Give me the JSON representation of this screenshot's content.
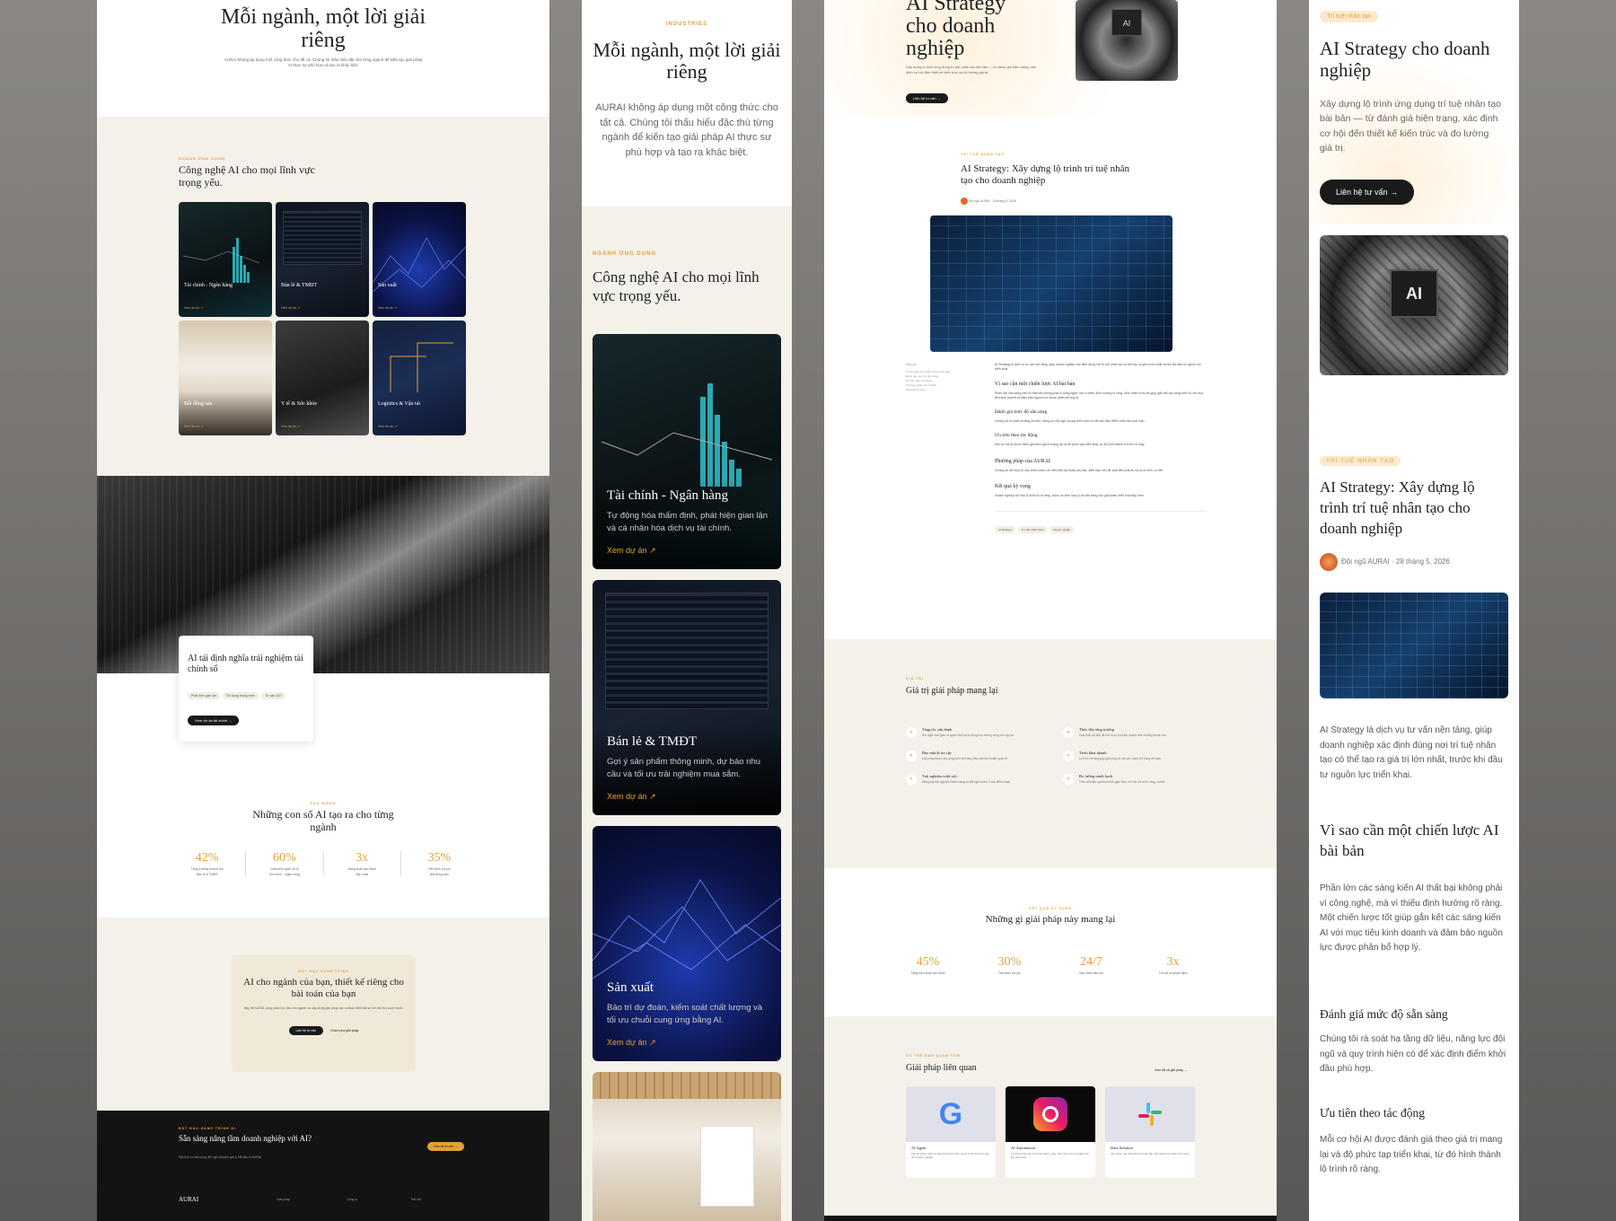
{
  "p1": {
    "hero_title": "Mỗi ngành, một lời giải riêng",
    "hero_desc": "AURAI không áp dụng một công thức cho tất cả. Chúng tôi thấu hiểu đặc thù từng ngành để kiến tạo giải pháp AI thực sự phù hợp và tạo ra khác biệt.",
    "section_eyebrow": "Ngành ứng dụng",
    "section_title": "Công nghệ AI cho mọi lĩnh vực trọng yếu.",
    "cards": [
      {
        "title": "Tài chính - Ngân hàng",
        "link": "Xem dự án"
      },
      {
        "title": "Bán lẻ & TMĐT",
        "link": "Xem dự án"
      },
      {
        "title": "Sản xuất",
        "link": "Xem dự án"
      },
      {
        "title": "Bất động sản",
        "link": "Xem dự án"
      },
      {
        "title": "Y tế & Sức khỏe",
        "link": "Xem dự án"
      },
      {
        "title": "Logistics & Vận tải",
        "link": "Xem dự án"
      }
    ],
    "feature_title": "AI tái định nghĩa trải nghiệm tài chính số",
    "feature_tags": [
      "Phát hiện gian lận",
      "Tín dụng thông minh",
      "Tư vấn 24/7"
    ],
    "feature_btn": "Xem dự án tài chính",
    "stats_eyebrow": "Tác động",
    "stats_title": "Những con số AI tạo ra cho từng ngành",
    "stats": [
      {
        "num": "42%",
        "lbl": "Tăng trưởng doanh thu",
        "cat": "Bán lẻ & TMĐT"
      },
      {
        "num": "60%",
        "lbl": "Giảm thời gian xử lý",
        "cat": "Tài chính - Ngân hàng"
      },
      {
        "num": "3x",
        "lbl": "Năng suất vận hành",
        "cat": "Sản xuất"
      },
      {
        "num": "35%",
        "lbl": "Tiết kiệm chi phí",
        "cat": "Bất động sản"
      }
    ],
    "cta_eyebrow": "Bắt đầu hành trình",
    "cta_title": "AI cho ngành của bạn, thiết kế riêng cho bài toán của bạn",
    "cta_desc": "Hãy để AURAI cùng phân tích đặc thù ngành và xây dựng giải pháp tạo ra khác biệt thật sự với đối thủ cạnh tranh.",
    "cta_btn1": "Liên hệ tư vấn",
    "cta_btn2": "Khám phá giải pháp",
    "footer_eyebrow": "Bắt đầu hành trình AI",
    "footer_title": "Sẵn sàng nâng tầm doanh nghiệp với AI?",
    "footer_desc": "Đặt lịch tư vấn cùng đội ngũ chuyên gia & bắt đầu ở AURAI.",
    "footer_btn": "Liên hệ tư vấn",
    "footer_brand": "AURAI",
    "footer_cols": [
      "Giải pháp",
      "Công ty",
      "Kết nối"
    ]
  },
  "p2": {
    "eyebrow": "Industries",
    "title": "Mỗi ngành, một lời giải riêng",
    "desc": "AURAI không áp dụng một công thức cho tất cả. Chúng tôi thấu hiểu đặc thù từng ngành để kiến tạo giải pháp AI thực sự phù hợp và tạo ra khác biệt.",
    "section_eyebrow": "Ngành ứng dụng",
    "section_title": "Công nghệ AI cho mọi lĩnh vực trọng yếu.",
    "cards": [
      {
        "title": "Tài chính - Ngân hàng",
        "desc": "Tự động hóa thẩm định, phát hiện gian lận và cá nhân hóa dịch vụ tài chính.",
        "link": "Xem dự án"
      },
      {
        "title": "Bán lẻ & TMĐT",
        "desc": "Gợi ý sản phẩm thông minh, dự báo nhu cầu và tối ưu trải nghiệm mua sắm.",
        "link": "Xem dự án"
      },
      {
        "title": "Sản xuất",
        "desc": "Bảo trì dự đoán, kiểm soát chất lượng và tối ưu chuỗi cung ứng bằng AI.",
        "link": "Xem dự án"
      }
    ]
  },
  "p3": {
    "hero_title": "AI Strategy cho doanh nghiệp",
    "hero_desc": "Xây dựng lộ trình ứng dụng trí tuệ nhân tạo bài bản — từ đánh giá hiện trạng, xác định cơ hội đến thiết kế kiến trúc và đo lường giá trị.",
    "hero_btn": "Liên hệ tư vấn",
    "article_eyebrow": "Trí tuệ nhân tạo",
    "article_title": "AI Strategy: Xây dựng lộ trình trí tuệ nhân tạo cho doanh nghiệp",
    "author": "Đội ngũ AURAI",
    "date": "28 tháng 5, 2026",
    "toc_title": "Mục lục",
    "toc": [
      "Vì sao cần một chiến lược AI bài bản",
      "Đánh giá mức độ sẵn sàng",
      "Ưu tiên theo tác động",
      "Phương pháp của AURAI",
      "Kết quả kỳ vọng"
    ],
    "intro": "AI Strategy là dịch vụ tư vấn nền tảng, giúp doanh nghiệp xác định đúng nơi trí tuệ nhân tạo có thể tạo ra giá trị lớn nhất, trước khi đầu tư nguồn lực triển khai.",
    "sections": [
      {
        "h": "Vì sao cần một chiến lược AI bài bản",
        "p": "Phần lớn các sáng kiến AI thất bại không phải vì công nghệ, mà vì thiếu định hướng rõ ràng. Một chiến lược tốt giúp gắn kết các sáng kiến AI với mục tiêu kinh doanh và đảm bảo nguồn lực được phân bổ hợp lý."
      },
      {
        "h": "Đánh giá mức độ sẵn sàng",
        "p": "Chúng tôi rà soát hạ tầng dữ liệu, năng lực đội ngũ và quy trình hiện có để xác định điểm khởi đầu phù hợp."
      },
      {
        "h": "Ưu tiên theo tác động",
        "p": "Mỗi cơ hội AI được đánh giá theo giá trị mang lại và độ phức tạp triển khai, từ đó hình thành lộ trình rõ ràng."
      },
      {
        "h": "Phương pháp của AURAI",
        "p": "Chúng tôi kết hợp tư duy chiến lược với hiểu biết kỹ thuật sâu sắc, đảm bảo mỗi đề xuất đều khả thi và có lộ trình cụ thể."
      },
      {
        "h": "Kết quả kỳ vọng",
        "p": "Doanh nghiệp sở hữu lộ trình AI rõ ràng, được ưu tiên hợp lý và sẵn sàng cho giai đoạn triển khai tiếp theo."
      }
    ],
    "tags": [
      "AI Strategy",
      "Tư vấn chiến lược",
      "Doanh nghiệp"
    ],
    "values_eyebrow": "Giá trị",
    "values_title": "Giá trị giải pháp mang lại",
    "values": [
      {
        "h": "Tăng tốc vận hành",
        "p": "Rút ngắn thời gian ra quyết định và tự động hóa những công việc lặp lại."
      },
      {
        "h": "Thúc đẩy tăng trưởng",
        "p": "Khai thác dữ liệu để mở ra cơ hội kinh doanh mới và tăng doanh thu."
      },
      {
        "h": "Bảo mật & tin cậy",
        "p": "Giải pháp được xây dựng trên nền tảng bảo mật đạt chuẩn quốc tế."
      },
      {
        "h": "Triển khai nhanh",
        "p": "Lộ trình rõ ràng giúp giải pháp đi vào vận hành chỉ trong vài tuần."
      },
      {
        "h": "Trải nghiệm vượt trội",
        "p": "Nâng cấp trải nghiệm khách hàng và đội ngũ nội bộ ở mọi điểm chạm."
      },
      {
        "h": "Đo lường minh bạch",
        "p": "Theo dõi hiệu quả theo thời gian thực với các chỉ số rõ ràng, cụ thể."
      }
    ],
    "results_eyebrow": "Kết quả kỳ vọng",
    "results_title": "Những gì giải pháp này mang lại",
    "results": [
      {
        "num": "45%",
        "lbl": "Tăng hiệu suất vận hành"
      },
      {
        "num": "30%",
        "lbl": "Tiết kiệm chi phí"
      },
      {
        "num": "24/7",
        "lbl": "Vận hành liên tục"
      },
      {
        "num": "3x",
        "lbl": "Tốc độ ra quyết định"
      }
    ],
    "related_eyebrow": "Có thể bạn quan tâm",
    "related_title": "Giải pháp liên quan",
    "related_link": "Xem tất cả giải pháp",
    "related": [
      {
        "title": "AI Agent",
        "desc": "Tác tử thông minh tự động hóa quy trình và xử lý tác vụ phức tạp cho doanh nghiệp."
      },
      {
        "title": "AI Automation",
        "desc": "Tự động hóa quy trình vận hành, giảm thời gian xử lý và giảm chi phí vận hành."
      },
      {
        "title": "Data Solution",
        "desc": "Xây dựng nền tảng dữ liệu hiện đại, sẵn sàng cho phân tích và AI."
      }
    ]
  },
  "p4": {
    "badge": "Trí tuệ nhân tạo",
    "hero_title": "AI Strategy cho doanh nghiệp",
    "hero_desc": "Xây dựng lộ trình ứng dụng trí tuệ nhân tạo bài bản — từ đánh giá hiện trạng, xác định cơ hội đến thiết kế kiến trúc và đo lường giá trị.",
    "hero_btn": "Liên hệ tư vấn",
    "article_eyebrow": "Trí tuệ nhân tạo",
    "article_title": "AI Strategy: Xây dựng lộ trình trí tuệ nhân tạo cho doanh nghiệp",
    "author": "Đội ngũ AURAI",
    "date": "28 tháng 5, 2026",
    "intro": "AI Strategy là dịch vụ tư vấn nền tảng, giúp doanh nghiệp xác định đúng nơi trí tuệ nhân tạo có thể tạo ra giá trị lớn nhất, trước khi đầu tư nguồn lực triển khai.",
    "h1": "Vì sao cần một chiến lược AI bài bản",
    "p1": "Phần lớn các sáng kiến AI thất bại không phải vì công nghệ, mà vì thiếu định hướng rõ ràng. Một chiến lược tốt giúp gắn kết các sáng kiến AI với mục tiêu kinh doanh và đảm bảo nguồn lực được phân bổ hợp lý.",
    "h2": "Đánh giá mức độ sẵn sàng",
    "p2": "Chúng tôi rà soát hạ tầng dữ liệu, năng lực đội ngũ và quy trình hiện có để xác định điểm khởi đầu phù hợp.",
    "h3": "Ưu tiên theo tác động",
    "p3": "Mỗi cơ hội AI được đánh giá theo giá trị mang lại và độ phức tạp triển khai, từ đó hình thành lộ trình rõ ràng."
  },
  "icons": {
    "arrow": "→",
    "arrow_ne": "↗",
    "value": "✦"
  },
  "colors": {
    "accent": "#e0a236",
    "dark": "#1a1a1a",
    "beige": "#f3f1ea"
  }
}
